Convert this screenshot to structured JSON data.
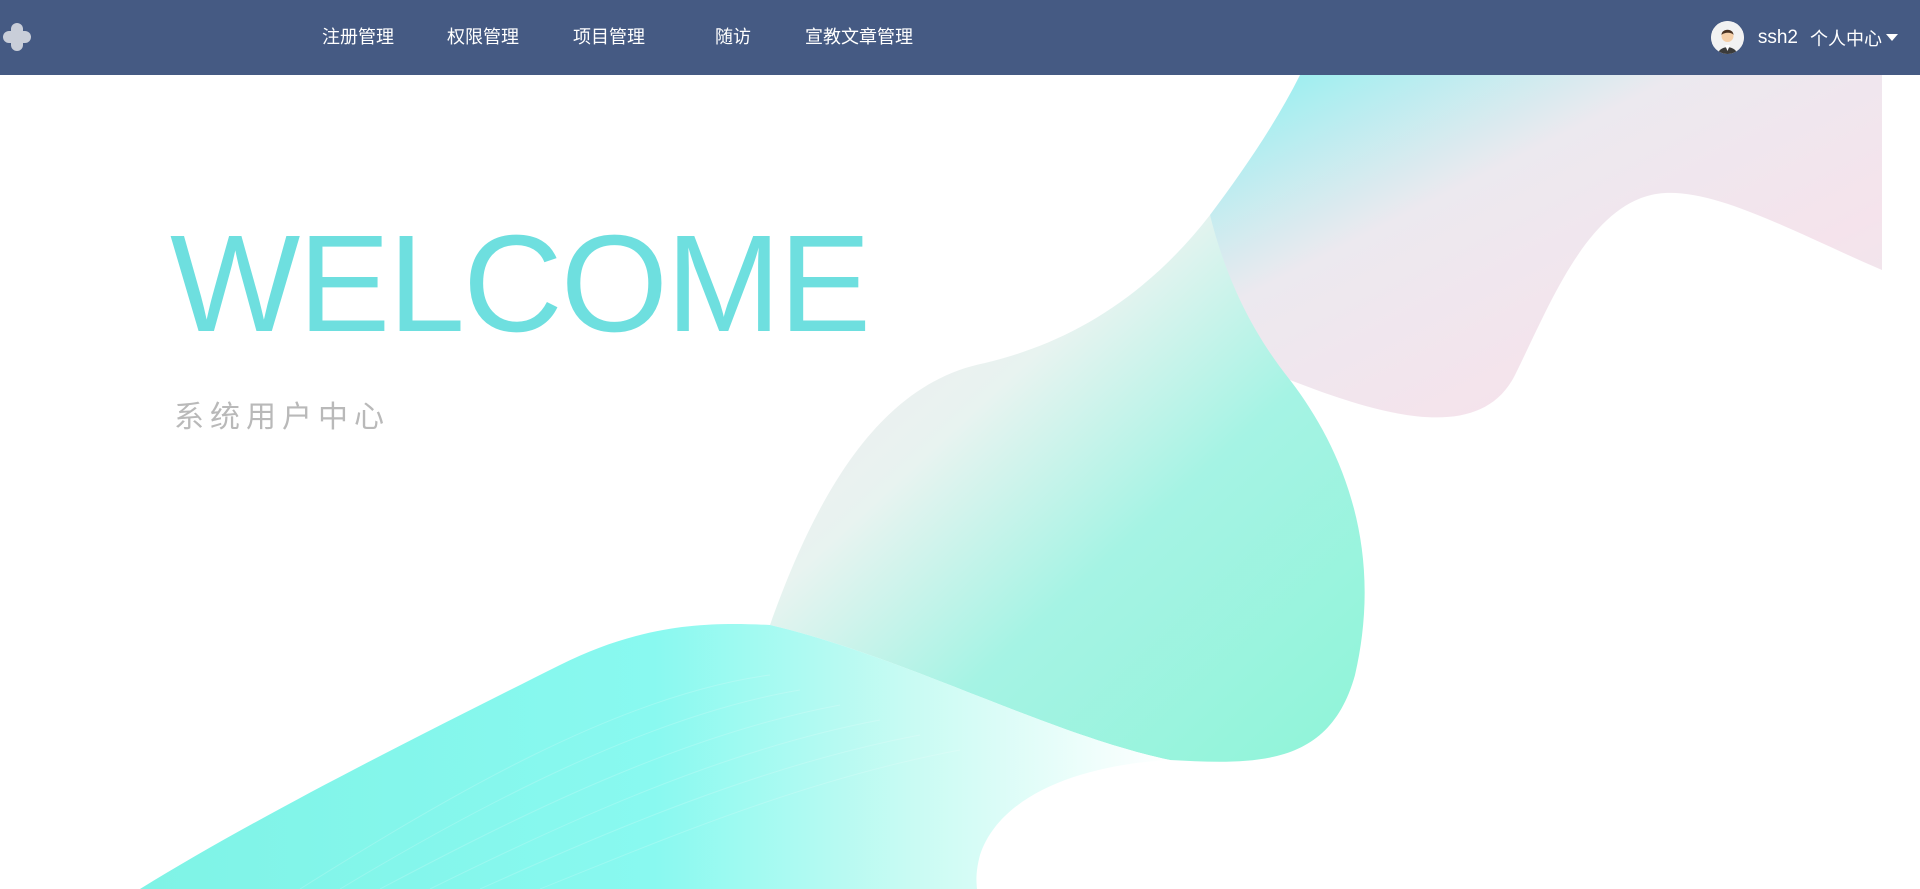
{
  "nav": {
    "items": [
      {
        "label": "注册管理"
      },
      {
        "label": "权限管理"
      },
      {
        "label": "项目管理"
      },
      {
        "label": "随访"
      },
      {
        "label": "宣教文章管理"
      }
    ]
  },
  "user": {
    "avatar_icon": "avatar-icon",
    "name": "ssh2",
    "center_label": "个人中心",
    "dropdown_icon": "caret-down-icon"
  },
  "hero": {
    "title": "WELCOME",
    "subtitle": "系统用户中心"
  },
  "colors": {
    "topbar": "#455a83",
    "title": "#6edfdf",
    "subtitle": "#b9b9b9",
    "wave_primary": "#7ff7e6",
    "wave_secondary": "#f3e5ee"
  },
  "icons": {
    "logo": "plus-logo-icon"
  }
}
